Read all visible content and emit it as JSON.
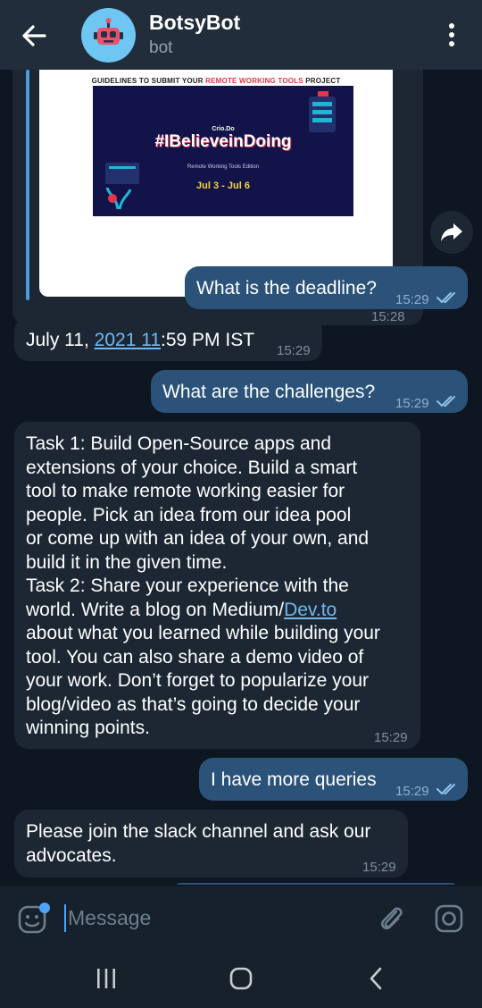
{
  "header": {
    "title": "BotsyBot",
    "subtitle": "bot"
  },
  "image_message": {
    "card_title_pre": "GUIDELINES TO SUBMIT YOUR ",
    "card_title_highlight": "REMOTE WORKING TOOLS",
    "card_title_post": " PROJECT",
    "poster_logo": "Crio.Do",
    "poster_tagline": "#IBelieveinDoing",
    "poster_subtitle": "Remote Working Tools Edition",
    "poster_dates": "Jul 3 - Jul 6",
    "time": "15:28"
  },
  "messages": [
    {
      "dir": "out",
      "text": "What is the deadline?",
      "time": "15:29"
    },
    {
      "dir": "in",
      "text_pre": "July 11, ",
      "link": "2021 11",
      "text_post": ":59 PM IST",
      "time": "15:29"
    },
    {
      "dir": "out",
      "text": "What are the challenges?",
      "time": "15:29"
    },
    {
      "dir": "in",
      "lines": [
        "Task 1: Build Open-Source apps and",
        "extensions of your choice. Build a smart",
        "tool to make remote working easier for",
        "people. Pick an idea from our idea pool",
        "or come up with an idea of your own, and",
        "build it in the given time.",
        "Task 2: Share your experience with the",
        "about what you learned while building your",
        "tool. You can also share a demo video of",
        "your work. Don’t forget to popularize your",
        "blog/video as that’s going to decide your",
        "winning points."
      ],
      "line_medium_pre": "world. Write a blog on Medium/",
      "line_medium_link": "Dev.to",
      "time": "15:29"
    },
    {
      "dir": "out",
      "text": "I have more queries",
      "time": "15:29"
    },
    {
      "dir": "in",
      "lines": [
        "Please join the slack channel and ask our",
        "advocates."
      ],
      "time": "15:29"
    }
  ],
  "input": {
    "placeholder": "Message"
  },
  "icons": {
    "back": "arrow-left-icon",
    "menu": "more-vertical-icon",
    "forward": "share-icon",
    "emoji": "sticker-icon",
    "attach": "paperclip-icon",
    "camera": "instagram-camera-icon"
  },
  "colors": {
    "header": "#212d3b",
    "chat_bg": "#0e1621",
    "incoming": "#1d2733",
    "outgoing": "#2b5278",
    "link": "#71b8f2",
    "accent": "#4ea4f6"
  }
}
